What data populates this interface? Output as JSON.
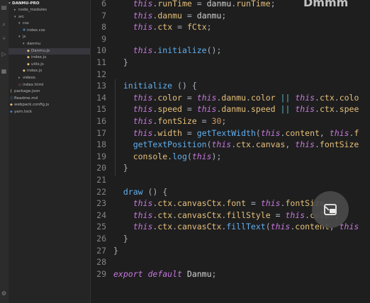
{
  "explorer": {
    "project": "DANMU-PRO",
    "items": [
      {
        "label": "node_modules",
        "icon": "folder-icon"
      },
      {
        "label": "src",
        "icon": "folder-open-icon"
      },
      {
        "label": "css",
        "icon": "folder-open-icon"
      },
      {
        "label": "index.css",
        "icon": "css-file-icon"
      },
      {
        "label": "js",
        "icon": "folder-open-icon"
      },
      {
        "label": "danmu",
        "icon": "folder-open-icon"
      },
      {
        "label": "Danmu.js",
        "icon": "js-file-icon"
      },
      {
        "label": "index.js",
        "icon": "js-file-icon"
      },
      {
        "label": "utils.js",
        "icon": "js-file-icon"
      },
      {
        "label": "index.js",
        "icon": "js-file-icon"
      },
      {
        "label": "videos",
        "icon": "folder-icon"
      },
      {
        "label": "index.html",
        "icon": "html-file-icon"
      },
      {
        "label": "package.json",
        "icon": "json-file-icon"
      },
      {
        "label": "Readme.md",
        "icon": "md-file-icon"
      },
      {
        "label": "webpack.config.js",
        "icon": "js-file-icon"
      },
      {
        "label": "yarn.lock",
        "icon": "lock-file-icon"
      }
    ]
  },
  "editor": {
    "lines": [
      {
        "n": "6",
        "code": "    this.runTime = danmu.runTime;"
      },
      {
        "n": "7",
        "code": "    this.danmu = danmu;"
      },
      {
        "n": "8",
        "code": "    this.ctx = fCtx;"
      },
      {
        "n": "9",
        "code": ""
      },
      {
        "n": "10",
        "code": "    this.initialize();"
      },
      {
        "n": "11",
        "code": "  }"
      },
      {
        "n": "12",
        "code": ""
      },
      {
        "n": "13",
        "code": "  initialize () {"
      },
      {
        "n": "14",
        "code": "    this.color = this.danmu.color || this.ctx.colo"
      },
      {
        "n": "15",
        "code": "    this.speed = this.danmu.speed || this.ctx.spee"
      },
      {
        "n": "16",
        "code": "    this.fontSize = 30;"
      },
      {
        "n": "17",
        "code": "    this.width = getTextWidth(this.content, this.f"
      },
      {
        "n": "18",
        "code": "    getTextPosition(this.ctx.canvas, this.fontSize"
      },
      {
        "n": "19",
        "code": "    console.log(this);"
      },
      {
        "n": "20",
        "code": "  }"
      },
      {
        "n": "21",
        "code": ""
      },
      {
        "n": "22",
        "code": "  draw () {"
      },
      {
        "n": "23",
        "code": "    this.ctx.canvasCtx.font = this.fontSize"
      },
      {
        "n": "24",
        "code": "    this.ctx.canvasCtx.fillStyle = this.color;"
      },
      {
        "n": "25",
        "code": "    this.ctx.canvasCtx.fillText(this.content, this"
      },
      {
        "n": "26",
        "code": "  }"
      },
      {
        "n": "27",
        "code": "}"
      },
      {
        "n": "28",
        "code": ""
      },
      {
        "n": "29",
        "code": "export default Danmu;"
      }
    ]
  },
  "overlay": {
    "watermark_text": "Dmmm",
    "fab_icon": "picture-in-picture-icon"
  },
  "colors": {
    "this": "#c678dd",
    "function": "#61afef",
    "property": "#e5c07b",
    "background": "#1e1e1e",
    "sidebar": "#252526"
  }
}
